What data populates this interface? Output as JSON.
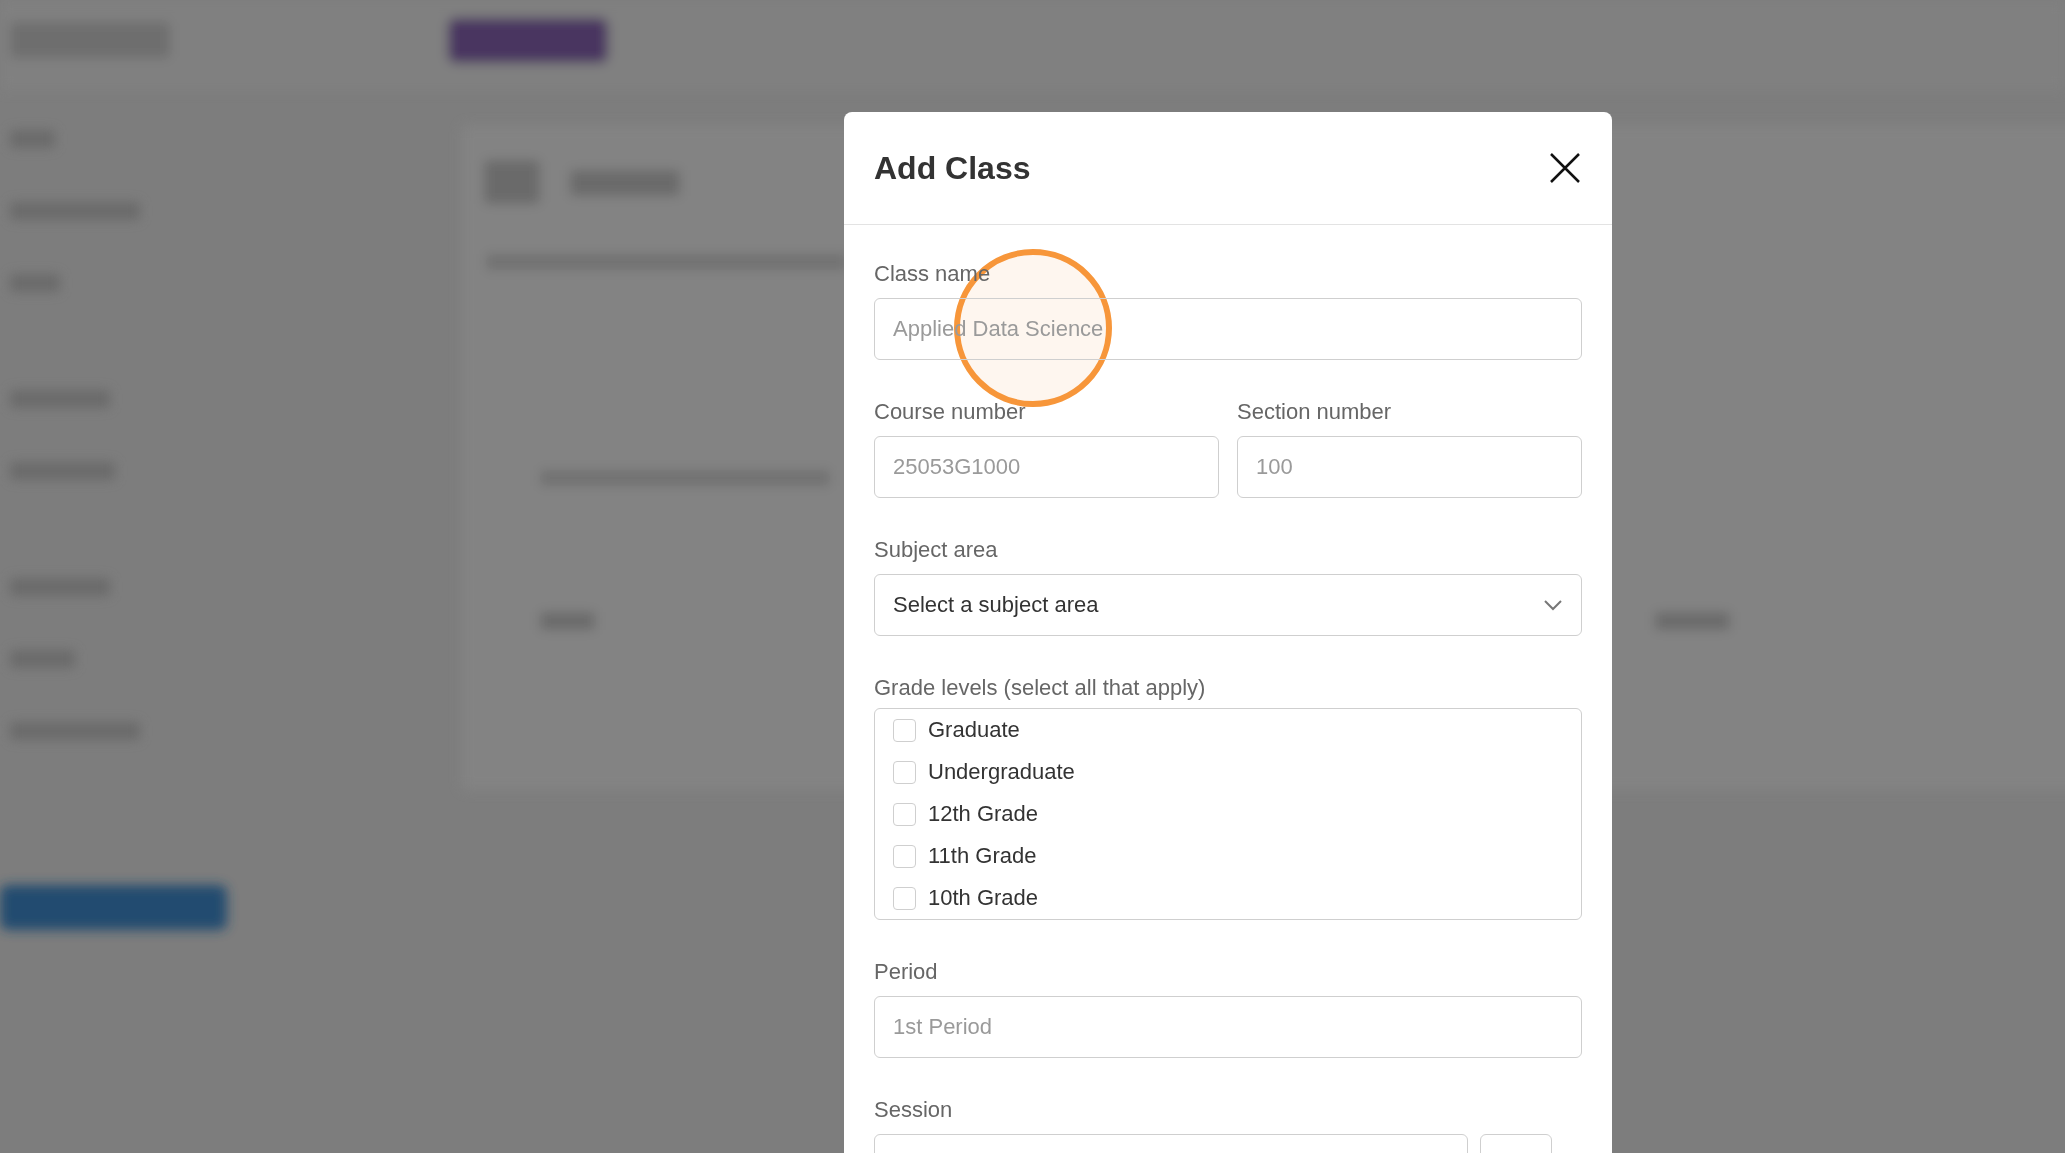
{
  "dialog": {
    "title": "Add Class",
    "fields": [
      {
        "kind": "text",
        "label": "Class name",
        "placeholder": "Applied Data Science"
      },
      {
        "kind": "pair",
        "items": [
          {
            "label": "Course number",
            "placeholder": "25053G1000"
          },
          {
            "label": "Section number",
            "placeholder": "100"
          }
        ]
      },
      {
        "kind": "select",
        "label": "Subject area",
        "value": "Select a subject area"
      },
      {
        "kind": "checklist",
        "label": "Grade levels (select all that apply)",
        "options": [
          {
            "label": "Graduate",
            "checked": false
          },
          {
            "label": "Undergraduate",
            "checked": false
          },
          {
            "label": "12th Grade",
            "checked": false
          },
          {
            "label": "11th Grade",
            "checked": false
          },
          {
            "label": "10th Grade",
            "checked": false
          }
        ]
      },
      {
        "kind": "text",
        "label": "Period",
        "placeholder": "1st Period"
      },
      {
        "kind": "session",
        "label": "Session"
      }
    ]
  }
}
